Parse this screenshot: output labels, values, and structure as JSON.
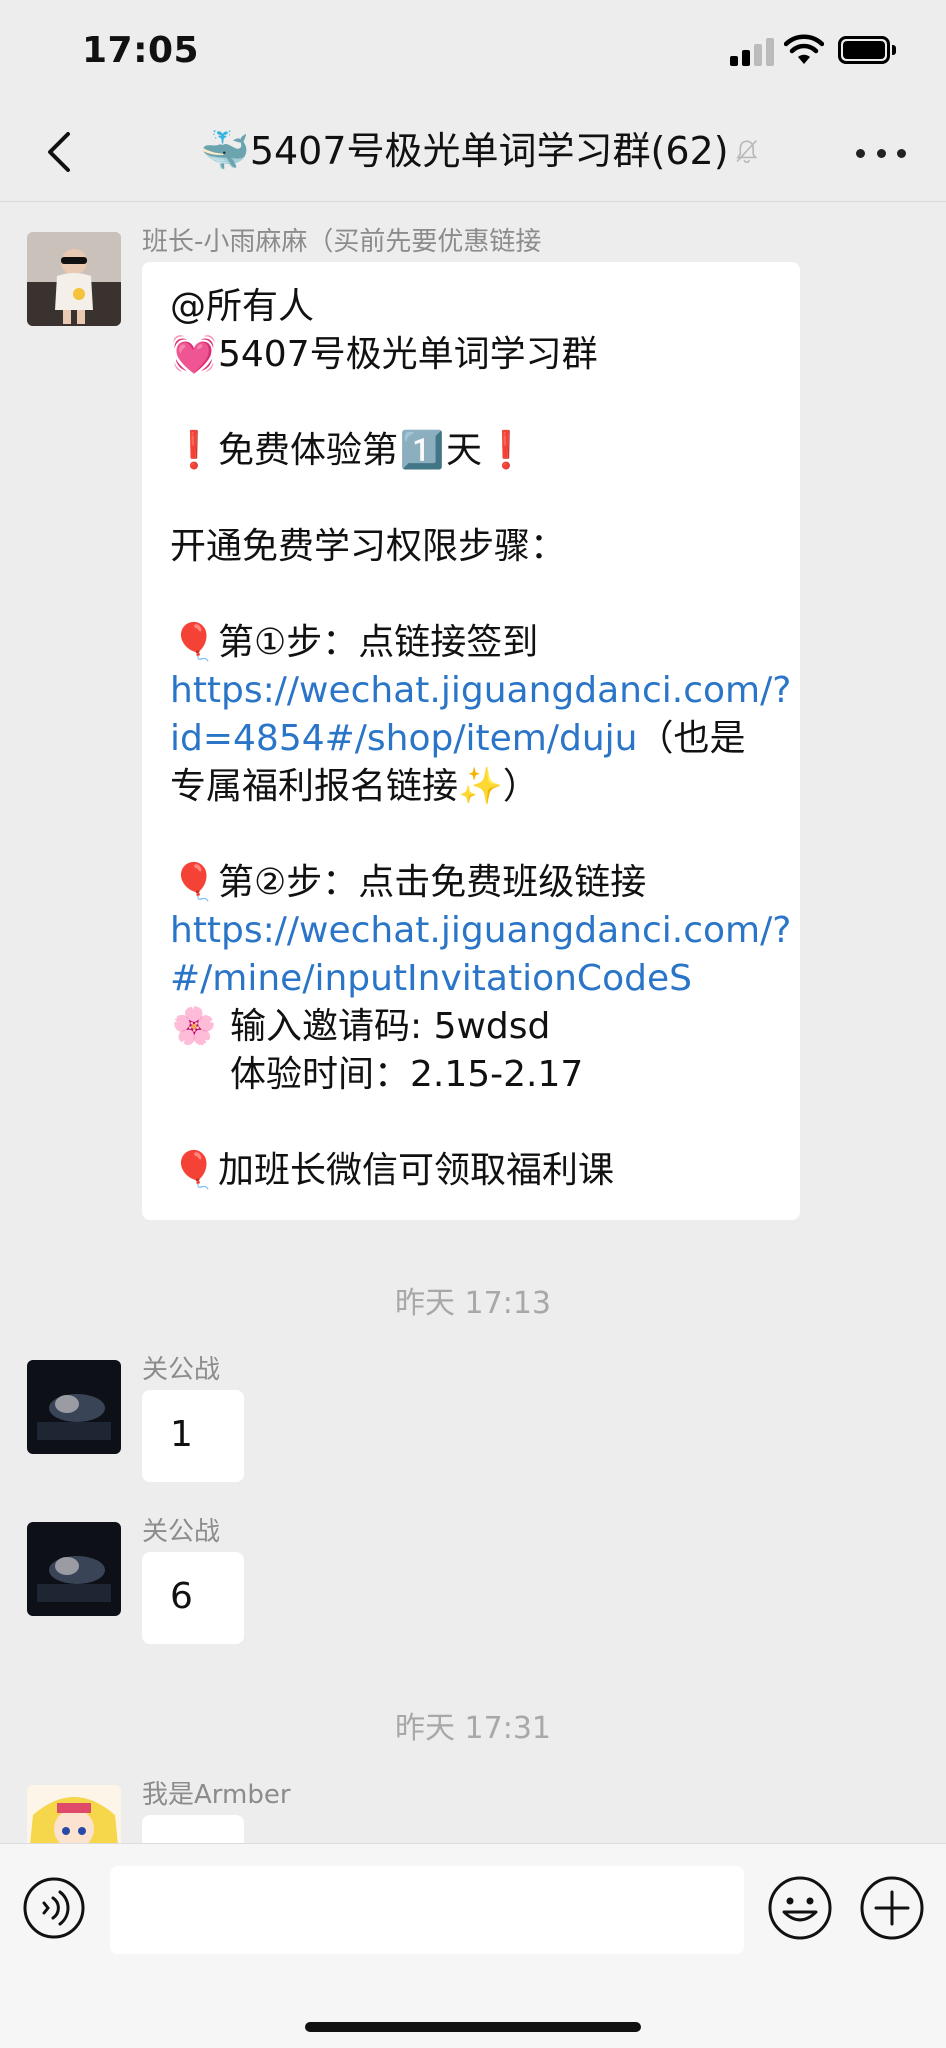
{
  "status_bar": {
    "time": "17:05",
    "icons": [
      "signal-icon",
      "wifi-icon",
      "battery-icon"
    ]
  },
  "nav": {
    "back_icon": "chevron-left-icon",
    "title_emoji": "🐳",
    "title": "5407号极光单词学习群(62)",
    "mute_icon": "bell-off-icon",
    "more_icon": "more-dots-icon"
  },
  "messages": [
    {
      "sender": "班长-小雨麻麻（买前先要优惠链接",
      "lines": {
        "l1": "@所有人",
        "l2_emoji": "💓",
        "l2": "5407号极光单词学习群",
        "l3_emoji_a": "❗",
        "l3_text_a": "免费体验第",
        "l3_emoji_b": "1️⃣",
        "l3_text_b": "天",
        "l3_emoji_c": "❗",
        "l4": "开通免费学习权限步骤：",
        "l5_emoji": "🎈",
        "l5": "第①步：点链接签到",
        "l6_link": "https://wechat.jiguangdanci.com/?",
        "l7_link": "id=4854#/shop/item/duju",
        "l7_text": "（也是",
        "l8": "专属福利报名链接",
        "l8_emoji": "✨",
        "l8_end": "）",
        "l9_emoji": "🎈",
        "l9": "第②步：点击免费班级链接",
        "l10_link": "https://wechat.jiguangdanci.com/?",
        "l11_link": "#/mine/inputInvitationCodeS",
        "l12_emoji": "🌸",
        "l12": "输入邀请码: 5wdsd",
        "l13": "体验时间：2.15-2.17",
        "l14_emoji": "🎈",
        "l14": "加班长微信可领取福利课"
      }
    },
    {
      "sender": "关公战",
      "text": "1"
    },
    {
      "sender": "关公战",
      "text": "6"
    },
    {
      "sender": "我是Armber",
      "text": ""
    }
  ],
  "timestamps": [
    "昨天 17:13",
    "昨天 17:31"
  ],
  "input_bar": {
    "voice_icon": "voice-icon",
    "input_value": "",
    "emoji_icon": "emoji-icon",
    "plus_icon": "plus-icon"
  },
  "colors": {
    "background": "#ededed",
    "bubble": "#ffffff",
    "link": "#2a75c7",
    "meta_text": "#8c8c8c",
    "timestamp": "#a8a8a8"
  }
}
